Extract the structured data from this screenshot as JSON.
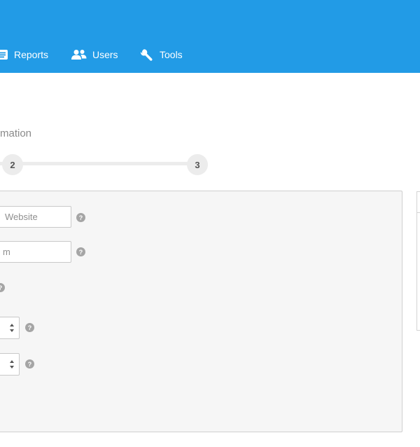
{
  "nav": {
    "reports_label": "Reports",
    "users_label": "Users",
    "tools_label": "Tools"
  },
  "section_title": "mation",
  "stepper": {
    "step2": "2",
    "step3": "3"
  },
  "form": {
    "field1_value": "Website",
    "field2_value": "m",
    "help_glyph": "?"
  },
  "colors": {
    "header_bg": "#229be6",
    "panel_bg": "#f6f6f6"
  }
}
